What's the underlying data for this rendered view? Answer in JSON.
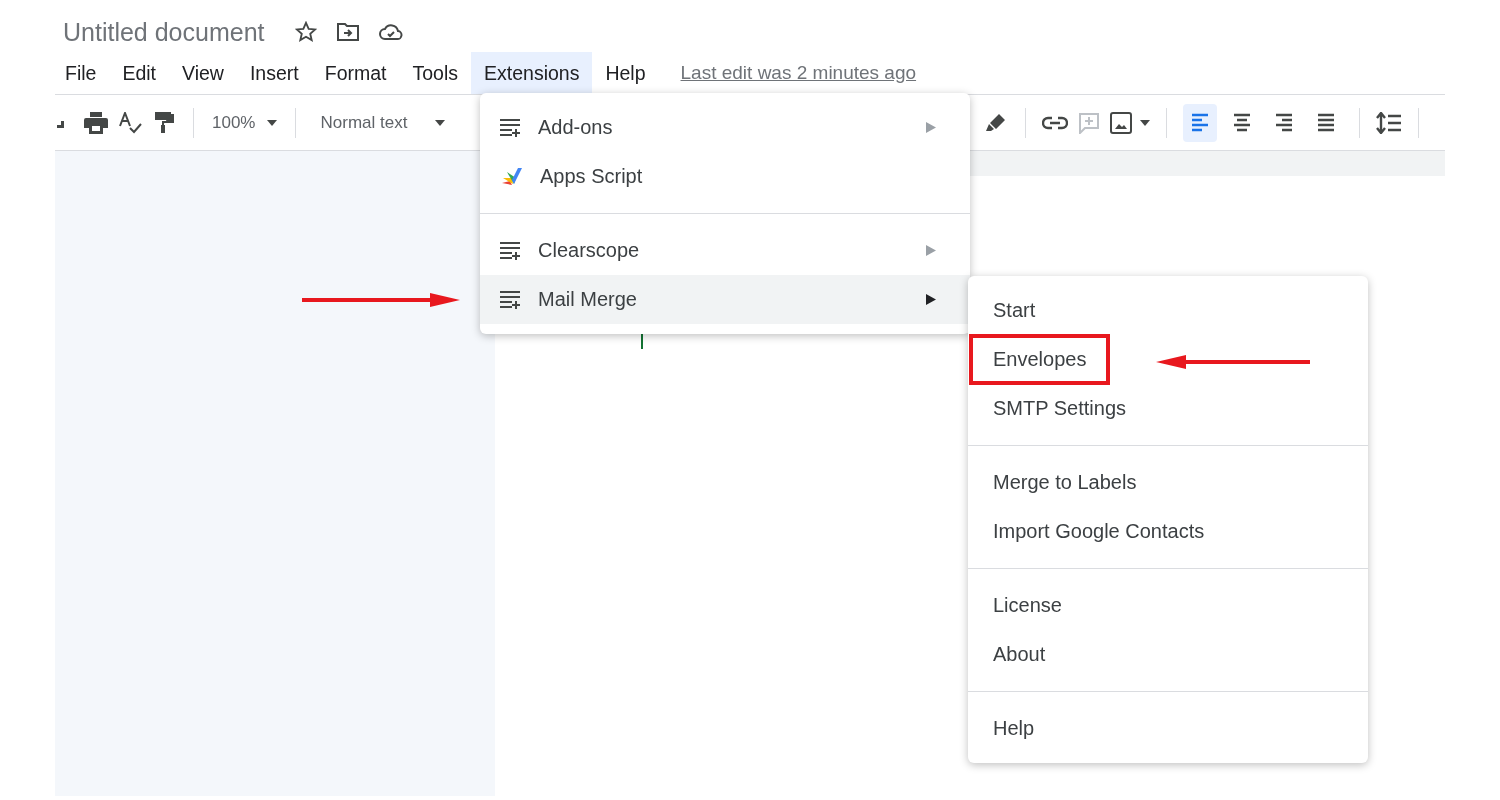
{
  "title": "Untitled document",
  "menu_bar": [
    {
      "label": "File",
      "selected": false
    },
    {
      "label": "Edit",
      "selected": false
    },
    {
      "label": "View",
      "selected": false
    },
    {
      "label": "Insert",
      "selected": false
    },
    {
      "label": "Format",
      "selected": false
    },
    {
      "label": "Tools",
      "selected": false
    },
    {
      "label": "Extensions",
      "selected": true
    },
    {
      "label": "Help",
      "selected": false
    }
  ],
  "last_edit": "Last edit was 2 minutes ago",
  "toolbar": {
    "zoom": "100%",
    "style": "Normal text",
    "alignments": [
      {
        "kind": "left",
        "selected": true
      },
      {
        "kind": "center",
        "selected": false
      },
      {
        "kind": "right",
        "selected": false
      },
      {
        "kind": "justify",
        "selected": false
      }
    ]
  },
  "extensions_menu": {
    "sections": [
      {
        "items": [
          {
            "label": "Add-ons",
            "kind": "addon",
            "submenu": true,
            "selected": false
          },
          {
            "label": "Apps Script",
            "kind": "apps-script",
            "submenu": false,
            "selected": false
          }
        ]
      },
      {
        "items": [
          {
            "label": "Clearscope",
            "kind": "addon",
            "submenu": true,
            "selected": false
          },
          {
            "label": "Mail Merge",
            "kind": "addon",
            "submenu": true,
            "selected": true
          }
        ]
      }
    ]
  },
  "mail_merge_menu": {
    "sections": [
      {
        "items": [
          {
            "label": "Start",
            "boxed": false
          },
          {
            "label": "Envelopes",
            "boxed": true
          },
          {
            "label": "SMTP Settings",
            "boxed": false
          }
        ]
      },
      {
        "items": [
          {
            "label": "Merge to Labels",
            "boxed": false
          },
          {
            "label": "Import Google Contacts",
            "boxed": false
          }
        ]
      },
      {
        "items": [
          {
            "label": "License",
            "boxed": false
          },
          {
            "label": "About",
            "boxed": false
          }
        ]
      },
      {
        "items": [
          {
            "label": "Help",
            "boxed": false
          }
        ]
      }
    ]
  }
}
